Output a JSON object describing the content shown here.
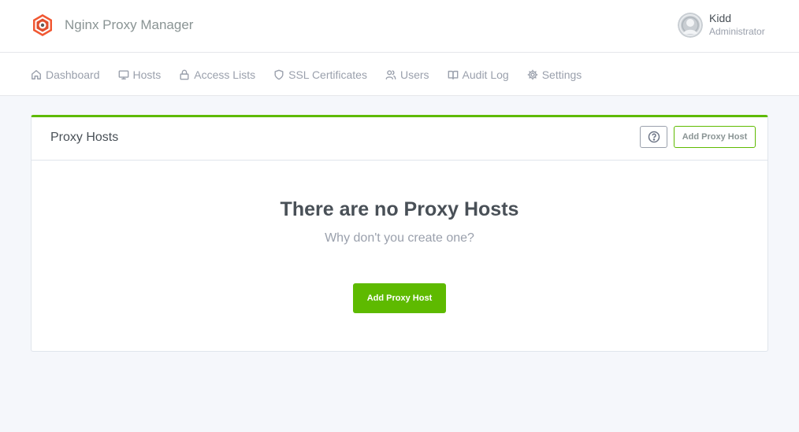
{
  "app": {
    "name": "Nginx Proxy Manager",
    "logo_icon": "nginx-proxy-manager-logo",
    "accent_color": "#5eba00"
  },
  "user": {
    "name": "Kidd",
    "role": "Administrator",
    "avatar_icon": "user-avatar"
  },
  "nav": {
    "items": [
      {
        "label": "Dashboard",
        "icon": "home-icon"
      },
      {
        "label": "Hosts",
        "icon": "monitor-icon"
      },
      {
        "label": "Access Lists",
        "icon": "lock-icon"
      },
      {
        "label": "SSL Certificates",
        "icon": "shield-icon"
      },
      {
        "label": "Users",
        "icon": "users-icon"
      },
      {
        "label": "Audit Log",
        "icon": "book-icon"
      },
      {
        "label": "Settings",
        "icon": "gear-icon"
      }
    ]
  },
  "card": {
    "title": "Proxy Hosts",
    "help_icon": "help-circle-icon",
    "add_button_label": "Add Proxy Host",
    "empty_title": "There are no Proxy Hosts",
    "empty_subtitle": "Why don't you create one?",
    "empty_button_label": "Add Proxy Host"
  }
}
